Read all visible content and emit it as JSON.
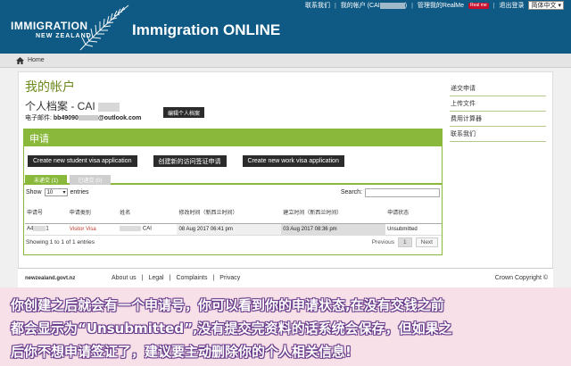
{
  "header": {
    "logo_line1": "IMMIGRATION",
    "logo_line2": "NEW ZEALAND",
    "app_title": "Immigration ONLINE",
    "links": {
      "contact": "联系我们",
      "my_account": "我的帐户 (CAI",
      "manage_realme": "管理我的RealMe",
      "realme_badge": "Real me",
      "logout": "退出登录",
      "language": "简体中文"
    }
  },
  "breadcrumb": {
    "home": "Home"
  },
  "page": {
    "title": "我的帐户",
    "profile_label": "个人档案 - CAI",
    "email_label": "电子邮件:",
    "email_prefix": "bb49090",
    "email_suffix": "@outlook.com",
    "edit_profile_button": "编辑个人档案"
  },
  "sidebar": {
    "items": [
      {
        "label": "递交申请"
      },
      {
        "label": "上传文件"
      },
      {
        "label": "费用计算器"
      },
      {
        "label": "联系我们"
      }
    ]
  },
  "applications": {
    "heading": "申请",
    "buttons": {
      "new_student": "Create new student visa application",
      "new_visitor": "创建新的访问签证申请",
      "new_work": "Create new work visa application"
    },
    "tabs": {
      "unsubmitted": "未递交 (1)",
      "submitted": "已递交 (0)"
    },
    "show_label": "Show",
    "page_size": "10",
    "entries_label": "entries",
    "search_label": "Search:",
    "columns": [
      "申请号",
      "申请类别",
      "姓名",
      "修改时间（新西兰时间）",
      "建立时间（新西兰时间）",
      "申请状态"
    ],
    "rows": [
      {
        "ref_prefix": "A4",
        "ref_suffix": "1",
        "category": "Visitor Visa",
        "name": "CAI",
        "modified": "08 Aug 2017 06:41 pm",
        "created": "03 Aug 2017 08:36 pm",
        "status": "Unsubmitted"
      }
    ],
    "paging_info": "Showing 1 to 1 of 1 entries",
    "pager": {
      "previous": "Previous",
      "page": "1",
      "next": "Next"
    }
  },
  "footer": {
    "govt": "newzealand.govt.nz",
    "links": [
      "About us",
      "Legal",
      "Complaints",
      "Privacy"
    ],
    "separator": "|",
    "copyright": "Crown Copyright ©"
  },
  "caption": {
    "line1": "你创建之后就会有一个申请号，你可以看到你的申请状态,在没有交钱之前",
    "line2": "都会显示为“Unsubmitted”,没有提交完资料的话系统会保存，但如果之",
    "line3": "后你不想申请签证了，建议要主动删除你的个人相关信息!"
  },
  "colors": {
    "header_blue": "#0f5a85",
    "accent_green": "#8ab83a",
    "title_green": "#6b8a1c",
    "caption_outline": "#6a3a8a"
  }
}
